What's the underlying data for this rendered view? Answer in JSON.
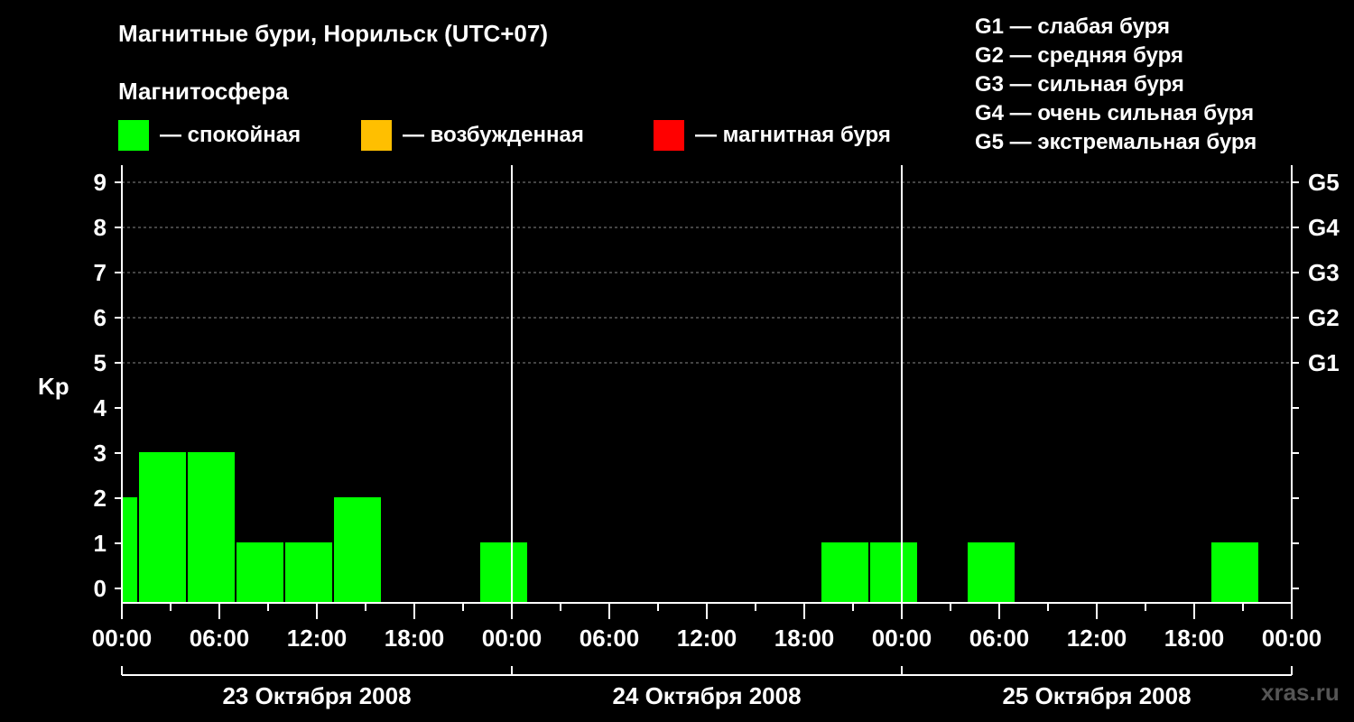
{
  "header": {
    "title": "Магнитные бури, Норильск (UTC+07)",
    "subtitle": "Магнитосфера"
  },
  "legend": [
    {
      "label": "— спокойная",
      "color": "#00ff00"
    },
    {
      "label": "— возбужденная",
      "color": "#ffbf00"
    },
    {
      "label": "— магнитная буря",
      "color": "#ff0000"
    }
  ],
  "g_scale": [
    "G1 — слабая буря",
    "G2 — средняя буря",
    "G3 — сильная буря",
    "G4 — очень сильная буря",
    "G5 — экстремальная буря"
  ],
  "watermark": "xras.ru",
  "chart_data": {
    "type": "bar",
    "ylabel": "Kp",
    "ylim": [
      0,
      9
    ],
    "y_ticks": [
      "0",
      "1",
      "2",
      "3",
      "4",
      "5",
      "6",
      "7",
      "8",
      "9"
    ],
    "right_ticks": [
      {
        "level": 5,
        "label": "G1"
      },
      {
        "level": 6,
        "label": "G2"
      },
      {
        "level": 7,
        "label": "G3"
      },
      {
        "level": 8,
        "label": "G4"
      },
      {
        "level": 9,
        "label": "G5"
      }
    ],
    "x_tick_labels": [
      "00:00",
      "06:00",
      "12:00",
      "18:00",
      "00:00",
      "06:00",
      "12:00",
      "18:00",
      "00:00",
      "06:00",
      "12:00",
      "18:00",
      "00:00"
    ],
    "days": [
      "23 Октября 2008",
      "24 Октября 2008",
      "25 Октября 2008"
    ],
    "x_range_hours": [
      0,
      72
    ],
    "bars": [
      {
        "start": 0,
        "end": 1,
        "kp": 2
      },
      {
        "start": 1,
        "end": 4,
        "kp": 3
      },
      {
        "start": 4,
        "end": 7,
        "kp": 3
      },
      {
        "start": 7,
        "end": 10,
        "kp": 1
      },
      {
        "start": 10,
        "end": 13,
        "kp": 1
      },
      {
        "start": 13,
        "end": 16,
        "kp": 2
      },
      {
        "start": 22,
        "end": 25,
        "kp": 1
      },
      {
        "start": 43,
        "end": 46,
        "kp": 1
      },
      {
        "start": 46,
        "end": 49,
        "kp": 1
      },
      {
        "start": 52,
        "end": 55,
        "kp": 1
      },
      {
        "start": 67,
        "end": 70,
        "kp": 1
      }
    ],
    "bar_color": "#00ff00",
    "gridlines": "dashed at Kp 5–9"
  }
}
